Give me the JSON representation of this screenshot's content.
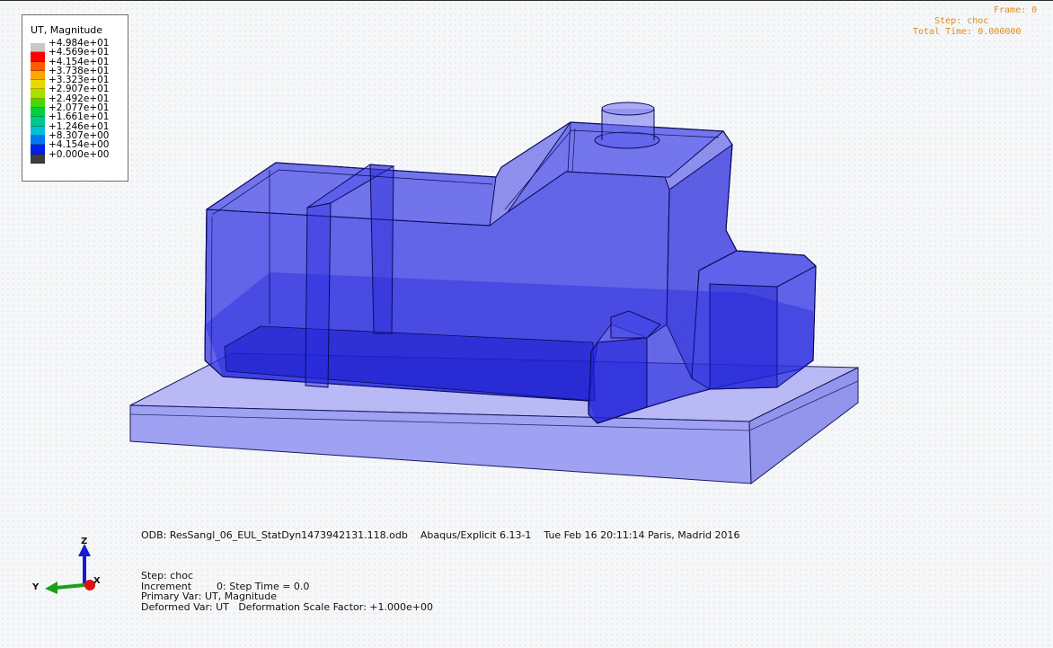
{
  "legend": {
    "title": "UT, Magnitude",
    "entries": [
      {
        "label": "+4.984e+01",
        "color": "#c8c8c8"
      },
      {
        "label": "+4.569e+01",
        "color": "#ff0000"
      },
      {
        "label": "+4.154e+01",
        "color": "#ff5a00"
      },
      {
        "label": "+3.738e+01",
        "color": "#ffa800"
      },
      {
        "label": "+3.323e+01",
        "color": "#e8d800"
      },
      {
        "label": "+2.907e+01",
        "color": "#a8e000"
      },
      {
        "label": "+2.492e+01",
        "color": "#46d800"
      },
      {
        "label": "+2.077e+01",
        "color": "#00d040"
      },
      {
        "label": "+1.661e+01",
        "color": "#00c890"
      },
      {
        "label": "+1.246e+01",
        "color": "#00c0d8"
      },
      {
        "label": "+8.307e+00",
        "color": "#0078f0"
      },
      {
        "label": "+4.154e+00",
        "color": "#0020e8"
      },
      {
        "label": "+0.000e+00",
        "color": "#3c3c3c"
      }
    ]
  },
  "step_info": {
    "step": "Step: choc",
    "frame": "Frame: 0",
    "total_time": "Total Time: 0.000000"
  },
  "footer": {
    "odb_line": "ODB: ResSangl_06_EUL_StatDyn1473942131.118.odb    Abaqus/Explicit 6.13-1    Tue Feb 16 20:11:14 Paris, Madrid 2016",
    "step": "Step: choc",
    "increment": "Increment        0: Step Time = 0.0",
    "primary_var": "Primary Var: UT, Magnitude",
    "deformed_var": "Deformed Var: UT   Deformation Scale Factor: +1.000e+00"
  },
  "triad": {
    "z_label": "Z",
    "y_label": "Y",
    "x_label": "X",
    "colors": {
      "z": "#1a1ad0",
      "y": "#1aa01a",
      "x": "#e01010"
    }
  },
  "model_colors": {
    "tank_fill": "#3a3ce6",
    "tank_edge": "#0a0a5a",
    "plate_fill": "#8a8cf0",
    "plate_edge": "#1a1a60"
  }
}
